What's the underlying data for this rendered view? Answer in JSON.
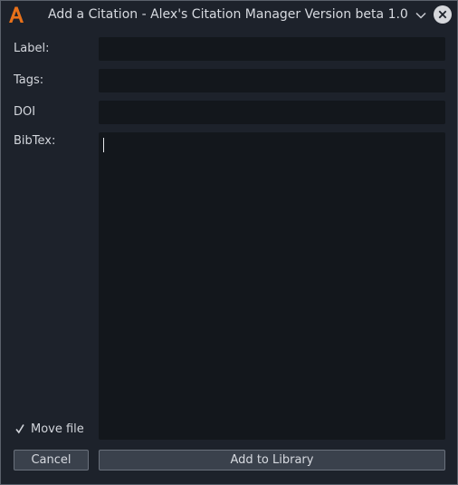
{
  "window": {
    "title": "Add a Citation - Alex's Citation Manager Version beta 1.0",
    "logo_icon": "app-logo-icon",
    "accent_color": "#e8711a"
  },
  "form": {
    "label_label": "Label:",
    "label_value": "",
    "tags_label": "Tags:",
    "tags_value": "",
    "doi_label": "DOI",
    "doi_value": "",
    "bibtex_label": "BibTex:",
    "bibtex_value": ""
  },
  "options": {
    "move_file_label": "Move file",
    "move_file_checked": true
  },
  "actions": {
    "cancel_label": "Cancel",
    "add_label": "Add to Library"
  }
}
